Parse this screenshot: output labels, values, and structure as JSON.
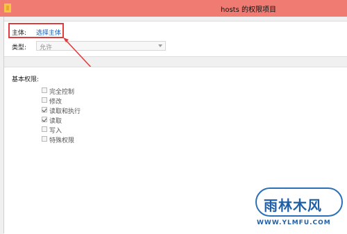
{
  "window": {
    "title": "hosts 的权限项目",
    "icon": "folder-icon"
  },
  "principal": {
    "label": "主体:",
    "link": "选择主体"
  },
  "type": {
    "label": "类型:",
    "selected": "允许"
  },
  "permissions": {
    "heading": "基本权限:",
    "items": [
      {
        "label": "完全控制",
        "checked": false
      },
      {
        "label": "修改",
        "checked": false
      },
      {
        "label": "读取和执行",
        "checked": true
      },
      {
        "label": "读取",
        "checked": true
      },
      {
        "label": "写入",
        "checked": false
      },
      {
        "label": "特殊权限",
        "checked": false
      }
    ]
  },
  "watermark": {
    "logo_text": "雨林木风",
    "url": "WWW.YLMFU.COM"
  },
  "colors": {
    "titlebar": "#f07b72",
    "highlight": "#e23b3b",
    "link": "#1a5fb4"
  }
}
